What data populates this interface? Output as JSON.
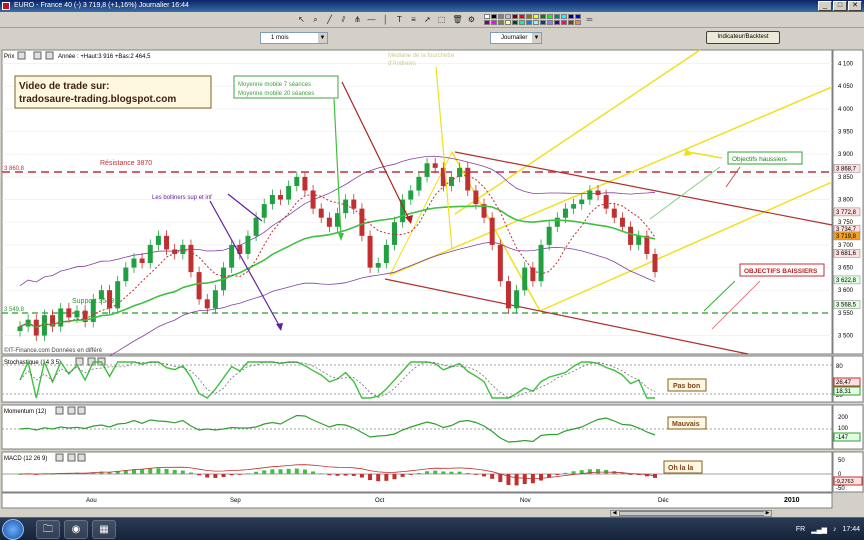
{
  "window": {
    "title": "EURO - France 40 (-)   3 719,8 (+1,16%)   Journalier  16:44",
    "controls": [
      "_",
      "□",
      "✕"
    ]
  },
  "toolbar2": {
    "period": "1 mois",
    "interval": "Journalier",
    "indicator_button": "Indicateur/Backtest"
  },
  "price_panel": {
    "header": "Prix",
    "stats": "Année : +Haut:3 916 +Bas:2 464,5",
    "axis_labels": [
      "4 150",
      "4 100",
      "4 050",
      "4 000",
      "3 950",
      "3 900",
      "3 850",
      "3 800",
      "3 750",
      "3 700",
      "3 650",
      "3 600",
      "3 550",
      "3 500"
    ],
    "value_tags": [
      "3 868,7",
      "3 772,8",
      "3 734,7",
      "3 719,8",
      "3 681,6",
      "3 622,8",
      "3 568,5"
    ],
    "resistance": {
      "value": "3 860,8",
      "label": "Résistance 3870"
    },
    "support": {
      "value": "3 549,8",
      "label": "Support 3549"
    },
    "copyright": "©IT-Finance.com  Données en différé"
  },
  "annotations": {
    "video_line1": "Video de trade sur:",
    "video_line2": "tradosaure-trading.blogspot.com",
    "mm_line1": "Moyenne mobile 7 séances",
    "mm_line2": "Moyenne mobile 20 séances",
    "andrews_line1": "Médiane de la fourchette",
    "andrews_line2": "d'Andrews",
    "bollinger": "Les bolliners sup et inf",
    "obj_haussiers": "Objectifs haussiers",
    "obj_baissiers": "OBJECTIFS BAISSIERS",
    "pas_bon": "Pas bon",
    "mauvais": "Mauvais",
    "oh_la_la": "Oh la la"
  },
  "stoch_panel": {
    "header": "Stochastique (14 3 5)",
    "axis_labels": [
      "80",
      "20"
    ],
    "value_tags": [
      "26,47",
      "18,31"
    ]
  },
  "momentum_panel": {
    "header": "Momentum (12)",
    "axis_labels": [
      "200",
      "100",
      "0"
    ],
    "value_tags": [
      "-147"
    ]
  },
  "macd_panel": {
    "header": "MACD (12 26 9)",
    "axis_labels": [
      "50",
      "0",
      "-50"
    ],
    "value_tags": [
      "-9,2763"
    ]
  },
  "x_axis": {
    "labels": [
      "Aou",
      "Sep",
      "Oct",
      "Nov",
      "Déc",
      "2010"
    ]
  },
  "taskbar": {
    "lang": "FR",
    "clock": "17:44"
  },
  "colors": {
    "resistance": "#c0303a",
    "support": "#2a9a2a",
    "andrews_fork": "#f0e020",
    "channel": "#b03030",
    "bollinger": "#8040a0",
    "mm7": "#c03030",
    "mm20": "#40c040",
    "candle_up": "#20a040",
    "candle_down": "#c03030"
  }
}
